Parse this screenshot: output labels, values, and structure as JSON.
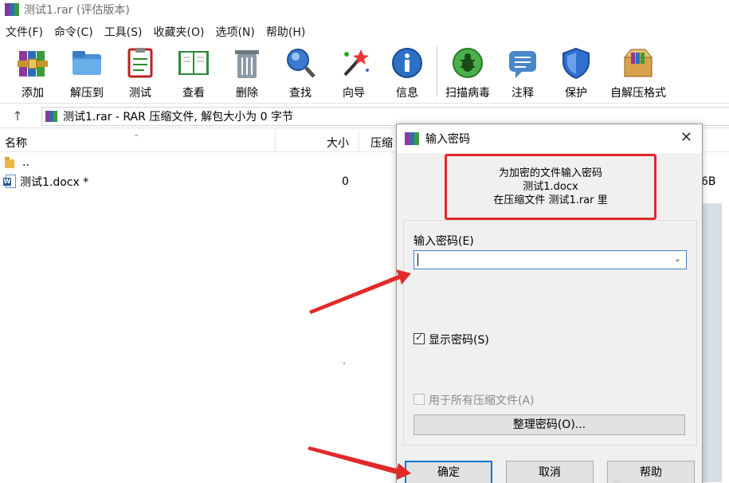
{
  "window": {
    "title": "测试1.rar (评估版本)"
  },
  "menu": [
    "文件(F)",
    "命令(C)",
    "工具(S)",
    "收藏夹(O)",
    "选项(N)",
    "帮助(H)"
  ],
  "toolbar": {
    "add": "添加",
    "extract": "解压到",
    "test": "测试",
    "view": "查看",
    "delete": "删除",
    "find": "查找",
    "wizard": "向导",
    "info": "信息",
    "scan": "扫描病毒",
    "comment": "注释",
    "protect": "保护",
    "sfx": "自解压格式"
  },
  "address": {
    "text": "测试1.rar - RAR 压缩文件, 解包大小为 0 字节"
  },
  "columns": {
    "name": "名称",
    "size": "大小",
    "packed": "压缩"
  },
  "files": [
    {
      "name": "..",
      "size": ""
    },
    {
      "name": "测试1.docx *",
      "size": "0"
    }
  ],
  "partial_right": "6B",
  "dialog": {
    "title": "输入密码",
    "info_line1": "为加密的文件输入密码",
    "info_line2": "测试1.docx",
    "info_line3": "在压缩文件 测试1.rar 里",
    "password_label": "输入密码(E)",
    "password_value": "",
    "show_password_label": "显示密码(S)",
    "show_password_checked": true,
    "use_for_all_label": "用于所有压缩文件(A)",
    "use_for_all_checked": false,
    "manage_button": "整理密码(O)...",
    "ok_button": "确定",
    "cancel_button": "取消",
    "help_button": "帮助"
  },
  "colors": {
    "annotation_red": "#e02a2a",
    "focus_blue": "#0078d7"
  },
  "watermark": "..."
}
